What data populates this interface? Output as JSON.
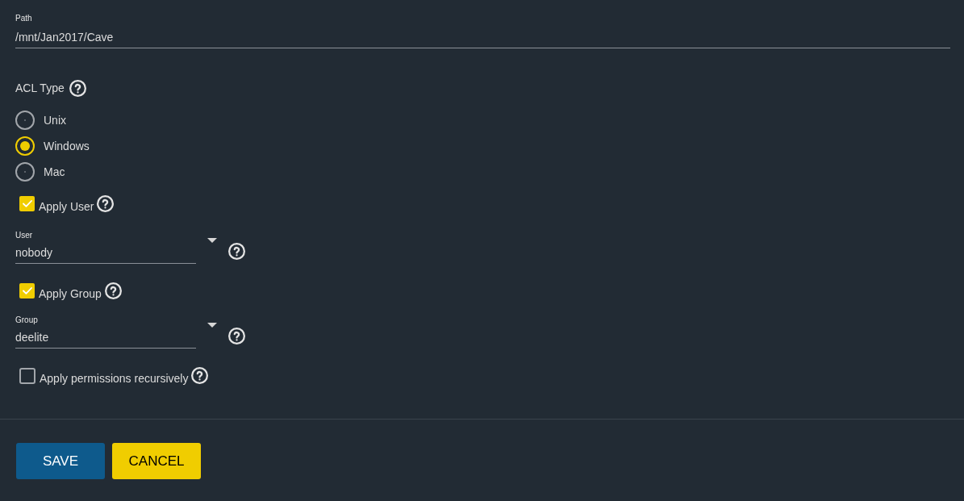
{
  "path": {
    "label": "Path",
    "value": "/mnt/Jan2017/Cave"
  },
  "acl_type": {
    "label": "ACL Type",
    "options": [
      {
        "label": "Unix",
        "selected": false
      },
      {
        "label": "Windows",
        "selected": true
      },
      {
        "label": "Mac",
        "selected": false
      }
    ]
  },
  "apply_user": {
    "label": "Apply User",
    "checked": true
  },
  "user": {
    "label": "User",
    "value": "nobody"
  },
  "apply_group": {
    "label": "Apply Group",
    "checked": true
  },
  "group": {
    "label": "Group",
    "value": "deelite"
  },
  "apply_recursive": {
    "label": "Apply permissions recursively",
    "checked": false
  },
  "buttons": [
    {
      "label": "SAVE",
      "kind": "primary"
    },
    {
      "label": "CANCEL",
      "kind": "secondary"
    }
  ]
}
